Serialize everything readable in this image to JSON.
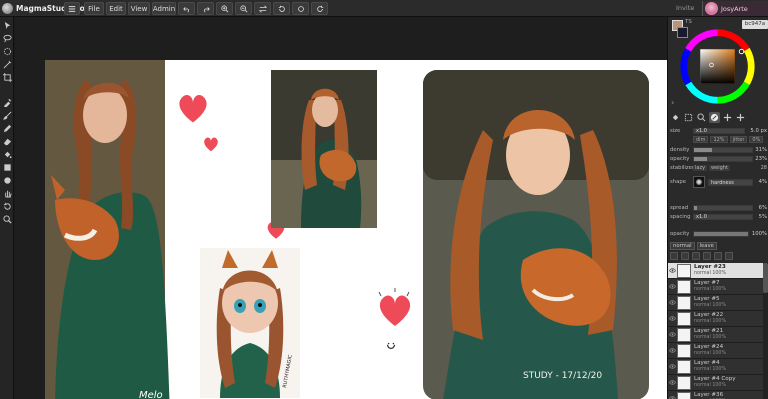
{
  "app": {
    "name": "MagmaStudio.io"
  },
  "menu": {
    "file": "File",
    "edit": "Edit",
    "view": "View",
    "admin": "Admin"
  },
  "toolbar_icons": [
    "hamburger-icon",
    "undo-icon",
    "redo-icon",
    "zoom-in-icon",
    "zoom-out-icon",
    "flip-icon",
    "rotate-left-icon",
    "rotate-reset-icon",
    "rotate-right-icon"
  ],
  "header": {
    "invite": "Invite",
    "user": "JosyArte"
  },
  "tools": [
    "move-icon",
    "lasso-icon",
    "ellipse-select-icon",
    "magic-wand-icon",
    "crop-icon",
    "eyedropper-icon",
    "brush-icon",
    "pencil-icon",
    "eraser-icon",
    "fill-icon",
    "rectangle-icon",
    "circle-icon",
    "hand-icon",
    "undo-tool-icon",
    "zoom-tool-icon"
  ],
  "colors": {
    "foreground": "#bc947a",
    "background": "#1a1a2e",
    "accent": "#e040a0",
    "hex_label": "bc947a",
    "ts_label": "TS"
  },
  "brush": {
    "size_label": "size",
    "size_value": "x1.0",
    "size_right": "5.0 px",
    "sub1": [
      "dim",
      "12%",
      "jitter",
      "0%"
    ],
    "density_label": "density",
    "density_value": "31%",
    "density_fill": 0.31,
    "opacity_label": "opacity",
    "opacity_value": "23%",
    "opacity_fill": 0.23,
    "stabilizer_label": "stabilizer",
    "stabilizer_chips": [
      "lazy",
      "weight",
      "28"
    ],
    "shape_label": "shape",
    "hardness_label": "hardness",
    "hardness_value": "4%",
    "spread_label": "spread",
    "spread_value": "6%",
    "spread_fill": 0.06,
    "spacing_label": "spacing",
    "spacing_mult": "x1.0",
    "spacing_value": "5%",
    "layer_opacity_label": "opacity",
    "layer_opacity_value": "100%"
  },
  "layer_controls": {
    "blend": "normal",
    "mode": "leave"
  },
  "layers": [
    {
      "name": "Layer #23",
      "mode": "normal 100%",
      "active": true
    },
    {
      "name": "Layer #7",
      "mode": "normal 100%",
      "active": false
    },
    {
      "name": "Layer #5",
      "mode": "normal 100%",
      "active": false
    },
    {
      "name": "Layer #22",
      "mode": "normal 100%",
      "active": false
    },
    {
      "name": "Layer #21",
      "mode": "normal 100%",
      "active": false
    },
    {
      "name": "Layer #24",
      "mode": "normal 100%",
      "active": false
    },
    {
      "name": "Layer #4",
      "mode": "normal 100%",
      "active": false
    },
    {
      "name": "Layer #4 Copy",
      "mode": "normal 100%",
      "active": false
    },
    {
      "name": "Layer #36",
      "mode": "normal 100%",
      "active": false
    }
  ],
  "artwork": {
    "signature_left": "Melo",
    "signature_small": "RUTHYMAGIC",
    "study_text": "STUDY - 17/12/20"
  }
}
